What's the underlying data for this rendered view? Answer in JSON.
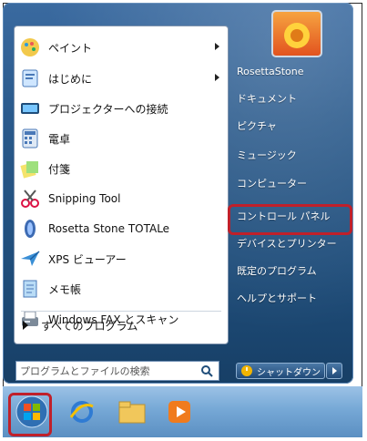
{
  "start_menu": {
    "left_items": [
      {
        "label": "ペイント",
        "icon": "paint-icon",
        "has_submenu": true
      },
      {
        "label": "はじめに",
        "icon": "getting-started-icon",
        "has_submenu": true
      },
      {
        "label": "プロジェクターへの接続",
        "icon": "projector-icon",
        "has_submenu": false
      },
      {
        "label": "電卓",
        "icon": "calculator-icon",
        "has_submenu": false
      },
      {
        "label": "付箋",
        "icon": "sticky-notes-icon",
        "has_submenu": false
      },
      {
        "label": "Snipping Tool",
        "icon": "scissors-icon",
        "has_submenu": false
      },
      {
        "label": "Rosetta Stone TOTALe",
        "icon": "rosetta-stone-icon",
        "has_submenu": false
      },
      {
        "label": "XPS ビューアー",
        "icon": "xps-viewer-icon",
        "has_submenu": false
      },
      {
        "label": "メモ帳",
        "icon": "notepad-icon",
        "has_submenu": false
      },
      {
        "label": "Windows FAX とスキャン",
        "icon": "fax-scan-icon",
        "has_submenu": false
      }
    ],
    "all_programs_label": "すべてのプログラム",
    "search_placeholder": "プログラムとファイルの検索",
    "right_items": [
      {
        "label": "RosettaStone"
      },
      {
        "label": "ドキュメント"
      },
      {
        "label": "ピクチャ"
      },
      {
        "label": "ミュージック"
      },
      {
        "label": "コンピューター"
      },
      {
        "label": "コントロール パネル",
        "highlighted": true
      },
      {
        "label": "デバイスとプリンター"
      },
      {
        "label": "既定のプログラム"
      },
      {
        "label": "ヘルプとサポート"
      }
    ],
    "shutdown_label": "シャットダウン"
  },
  "taskbar": {
    "items": [
      {
        "name": "start-button",
        "icon": "windows-logo-icon"
      },
      {
        "name": "internet-explorer",
        "icon": "internet-explorer-icon"
      },
      {
        "name": "windows-explorer",
        "icon": "folder-icon"
      },
      {
        "name": "media-player",
        "icon": "media-player-icon"
      }
    ]
  },
  "colors": {
    "highlight": "#c0202a",
    "menu_blue": "#2a5a8c",
    "taskbar": "#76a8d6"
  }
}
